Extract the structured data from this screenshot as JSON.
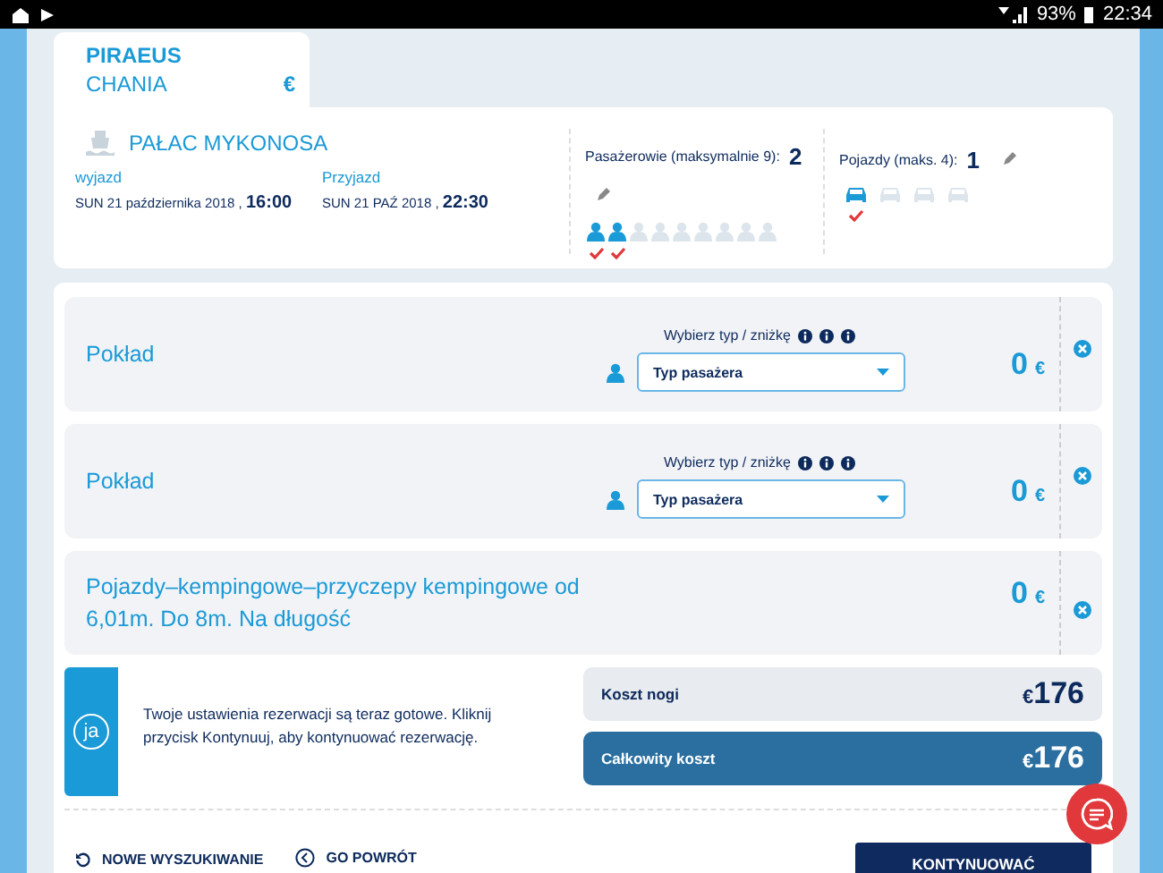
{
  "status_bar": {
    "battery": "93%",
    "time": "22:34"
  },
  "route": {
    "from": "PIRAEUS",
    "to": "CHANIA",
    "currency": "€"
  },
  "ship": {
    "name": "PAŁAC MYKONOSA"
  },
  "departure": {
    "label": "wyjazd",
    "date": "SUN 21 października 2018 ,",
    "time": "16:00"
  },
  "arrival": {
    "label": "Przyjazd",
    "date": "SUN 21 PAŹ 2018 ,",
    "time": "22:30"
  },
  "passengers": {
    "label": "Pasażerowie (maksymalnie 9):",
    "count": "2",
    "slots": [
      {
        "filled": true
      },
      {
        "filled": true
      },
      {
        "filled": false
      },
      {
        "filled": false
      },
      {
        "filled": false
      },
      {
        "filled": false
      },
      {
        "filled": false
      },
      {
        "filled": false
      },
      {
        "filled": false
      }
    ]
  },
  "vehicles": {
    "label": "Pojazdy (maks. 4):",
    "count": "1",
    "slots": [
      {
        "filled": true
      },
      {
        "filled": false
      },
      {
        "filled": false
      },
      {
        "filled": false
      }
    ]
  },
  "items": [
    {
      "kind": "passenger",
      "title": "Pokład",
      "hint": "Wybierz typ / zniżkę",
      "select": "Typ pasażera",
      "price": "0",
      "currency": "€"
    },
    {
      "kind": "passenger",
      "title": "Pokład",
      "hint": "Wybierz typ / zniżkę",
      "select": "Typ pasażera",
      "price": "0",
      "currency": "€"
    },
    {
      "kind": "vehicle",
      "title": "Pojazdy–kempingowe–przyczepy kempingowe od 6,01m. Do 8m. Na długość",
      "price": "0",
      "currency": "€"
    }
  ],
  "notice": {
    "badge": "ja",
    "text": "Twoje ustawienia rezerwacji są teraz gotowe. Kliknij przycisk Kontynuuj, aby kontynuować rezerwację."
  },
  "costs": [
    {
      "label": "Koszt nogi",
      "currency": "€",
      "amount": "176",
      "highlighted": false
    },
    {
      "label": "Całkowity koszt",
      "currency": "€",
      "amount": "176",
      "highlighted": true
    }
  ],
  "footer": {
    "links": [
      {
        "kind": "restart",
        "label": "NOWE WYSZUKIWANIE"
      },
      {
        "kind": "back",
        "label": "GO POWRÓT"
      }
    ],
    "primary": "KONTYNUOWAĆ"
  }
}
